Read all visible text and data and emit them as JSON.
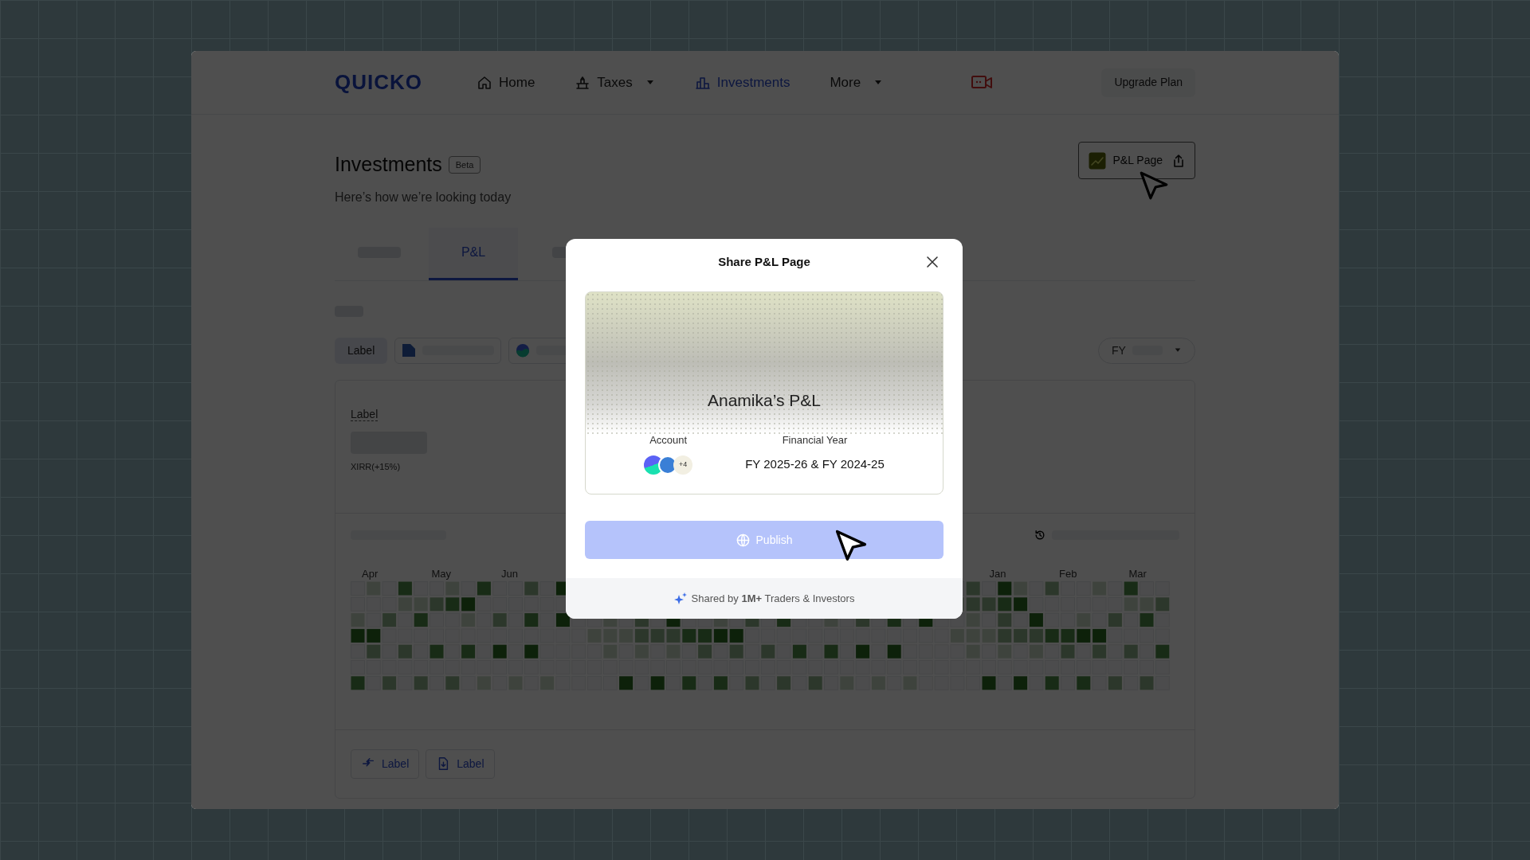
{
  "nav": {
    "logo": "QUICKO",
    "items": [
      {
        "label": "Home",
        "kind": "home",
        "selected": false,
        "menu": false
      },
      {
        "label": "Taxes",
        "kind": "taxes",
        "selected": false,
        "menu": true
      },
      {
        "label": "Investments",
        "kind": "investments",
        "selected": true,
        "menu": false
      },
      {
        "label": "More",
        "kind": "more",
        "selected": false,
        "menu": true
      }
    ],
    "upgrade": "Upgrade Plan"
  },
  "header": {
    "title": "Investments",
    "badge": "Beta",
    "subtitle": "Here’s how we’re looking today",
    "share_button": "P&L Page"
  },
  "tabs": [
    {
      "kind": "placeholder",
      "selected": false
    },
    {
      "kind": "text",
      "label": "P&L",
      "selected": true
    },
    {
      "kind": "placeholder",
      "selected": false
    }
  ],
  "filters": {
    "chip": "Label",
    "period": "FY"
  },
  "summary": {
    "label": "Label",
    "xirr": "XIRR(+15%)"
  },
  "heatmap": {
    "months": [
      "Apr",
      "May",
      "Jun",
      "Jan",
      "Feb",
      "Mar"
    ]
  },
  "actions": [
    {
      "kind": "compare",
      "label": "Label"
    },
    {
      "kind": "download",
      "label": "Label"
    }
  ],
  "modal": {
    "title": "Share P&L Page",
    "card_title": "Anamika’s P&L",
    "account_label": "Account",
    "account_more": "+4",
    "year_label": "Financial Year",
    "year_value": "FY 2025-26 & FY 2024-25",
    "publish": "Publish",
    "footer": "Shared by **1M+** Traders & Investors"
  }
}
